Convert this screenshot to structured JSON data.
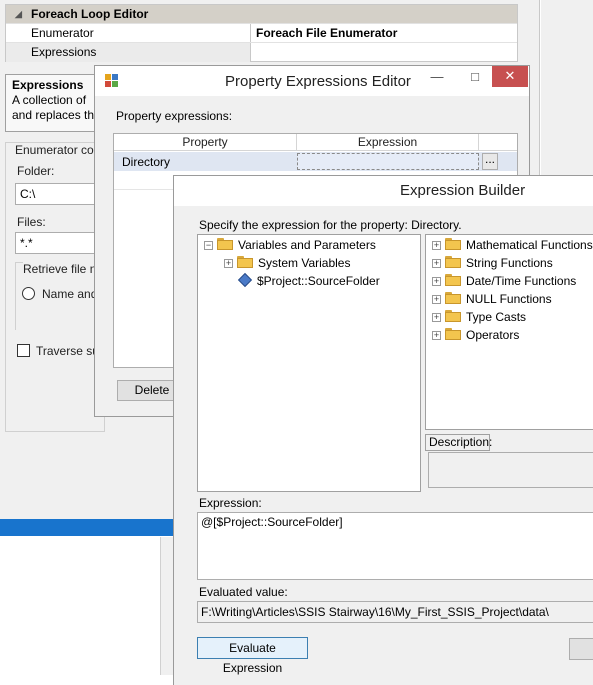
{
  "foreach_editor": {
    "category": "Foreach Loop Editor",
    "enumerator_label": "Enumerator",
    "enumerator_value": "Foreach File Enumerator",
    "expressions_label": "Expressions",
    "desc_title": "Expressions",
    "desc_line1": "A collection of",
    "desc_line2": "and replaces th",
    "config_group": "Enumerator co",
    "folder_label": "Folder:",
    "folder_value": "C:\\",
    "files_label": "Files:",
    "files_value": "*.*",
    "retrieve_label": "Retrieve file n",
    "name_option": "Name and",
    "traverse_label": "Traverse su"
  },
  "property_expressions_editor": {
    "title": "Property Expressions Editor",
    "property_expressions_label": "Property expressions:",
    "columns": [
      "Property",
      "Expression"
    ],
    "rows": [
      {
        "property": "Directory",
        "expression": ""
      }
    ],
    "ellipsis": "...",
    "delete_button": "Delete"
  },
  "expression_builder": {
    "title": "Expression Builder",
    "instruction": "Specify the expression for the property: Directory.",
    "variables_tree": {
      "root": "Variables and Parameters",
      "children": [
        "System Variables",
        "$Project::SourceFolder"
      ]
    },
    "functions_tree": [
      "Mathematical Functions",
      "String Functions",
      "Date/Time Functions",
      "NULL Functions",
      "Type Casts",
      "Operators"
    ],
    "description_label": "Description:",
    "expression_label": "Expression:",
    "expression_value": "@[$Project::SourceFolder]",
    "evaluated_label": "Evaluated value:",
    "evaluated_value": "F:\\Writing\\Articles\\SSIS Stairway\\16\\My_First_SSIS_Project\\data\\",
    "evaluate_button": "Evaluate Expression"
  }
}
